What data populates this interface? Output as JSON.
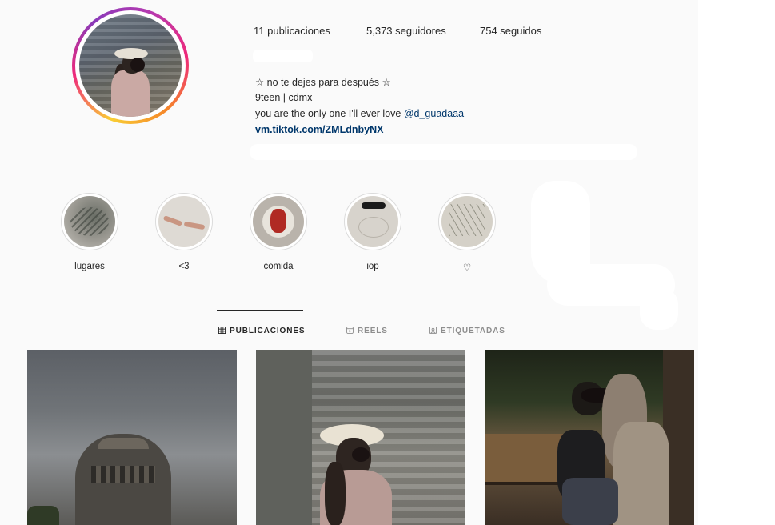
{
  "profile": {
    "stats": {
      "posts": "11 publicaciones",
      "followers": "5,373 seguidores",
      "following": "754 seguidos"
    },
    "bio": {
      "line1": "☆ no te dejes para después ☆",
      "line2": "9teen | cdmx",
      "line3_text": "you are the only one I'll ever love ",
      "line3_mention": "@d_guadaaa",
      "link": "vm.tiktok.com/ZMLdnbyNX"
    }
  },
  "highlights": [
    {
      "label": "lugares"
    },
    {
      "label": "<3"
    },
    {
      "label": "comida"
    },
    {
      "label": "iop"
    },
    {
      "label": "♡"
    }
  ],
  "tabs": [
    {
      "label": "PUBLICACIONES",
      "icon": "grid-icon",
      "active": true
    },
    {
      "label": "REELS",
      "icon": "reels-icon",
      "active": false
    },
    {
      "label": "ETIQUETADAS",
      "icon": "tagged-icon",
      "active": false
    }
  ],
  "colors": {
    "link": "#00376b",
    "border": "#dbdbdb",
    "muted": "#8e8e8e",
    "text": "#262626"
  }
}
